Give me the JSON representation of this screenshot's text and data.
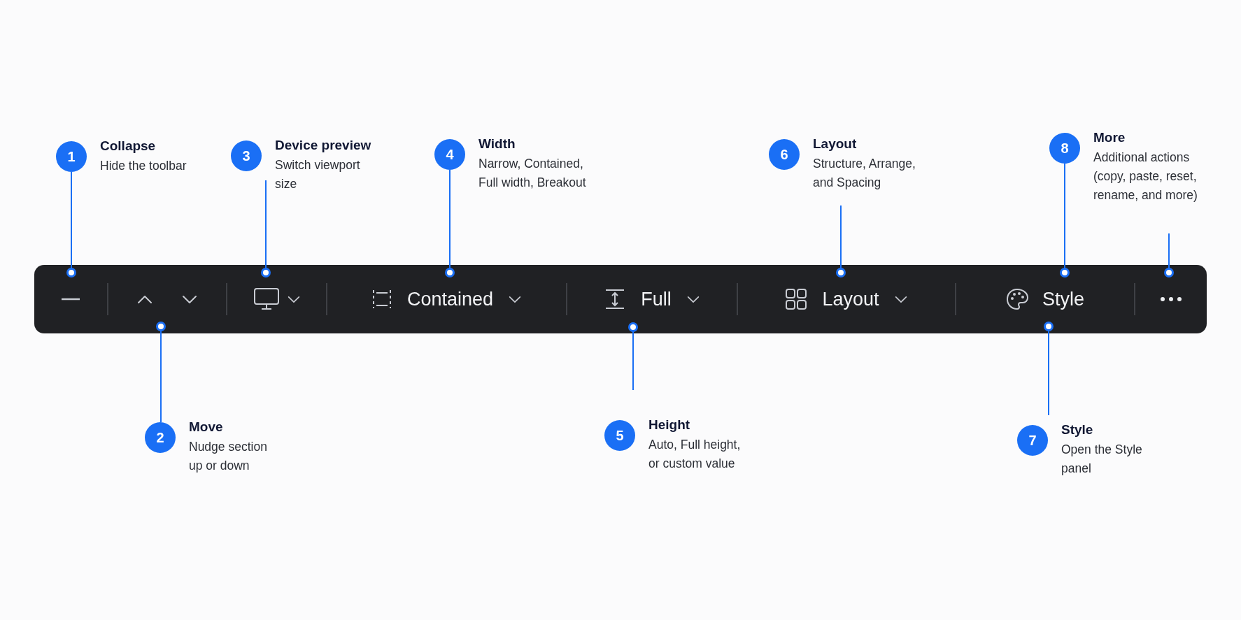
{
  "callouts": [
    {
      "number": "1",
      "title": "Collapse",
      "description": "Hide the toolbar"
    },
    {
      "number": "2",
      "title": "Move",
      "description": "Nudge section\nup or down"
    },
    {
      "number": "3",
      "title": "Device preview",
      "description": "Switch viewport\nsize"
    },
    {
      "number": "4",
      "title": "Width",
      "description": "Narrow, Contained,\nFull width, Breakout"
    },
    {
      "number": "5",
      "title": "Height",
      "description": "Auto, Full height,\nor custom value"
    },
    {
      "number": "6",
      "title": "Layout",
      "description": "Structure, Arrange,\nand Spacing"
    },
    {
      "number": "7",
      "title": "Style",
      "description": "Open the Style\npanel"
    },
    {
      "number": "8",
      "title": "More",
      "description": "Additional actions\n(copy, paste, reset,\nrename, and more)"
    }
  ],
  "toolbar": {
    "segments": [
      {
        "kind": "collapse"
      },
      {
        "kind": "move"
      },
      {
        "kind": "device"
      },
      {
        "kind": "width",
        "label": "Contained"
      },
      {
        "kind": "height",
        "label": "Full"
      },
      {
        "kind": "layout",
        "label": "Layout"
      },
      {
        "kind": "style",
        "label": "Style"
      },
      {
        "kind": "more"
      }
    ]
  }
}
